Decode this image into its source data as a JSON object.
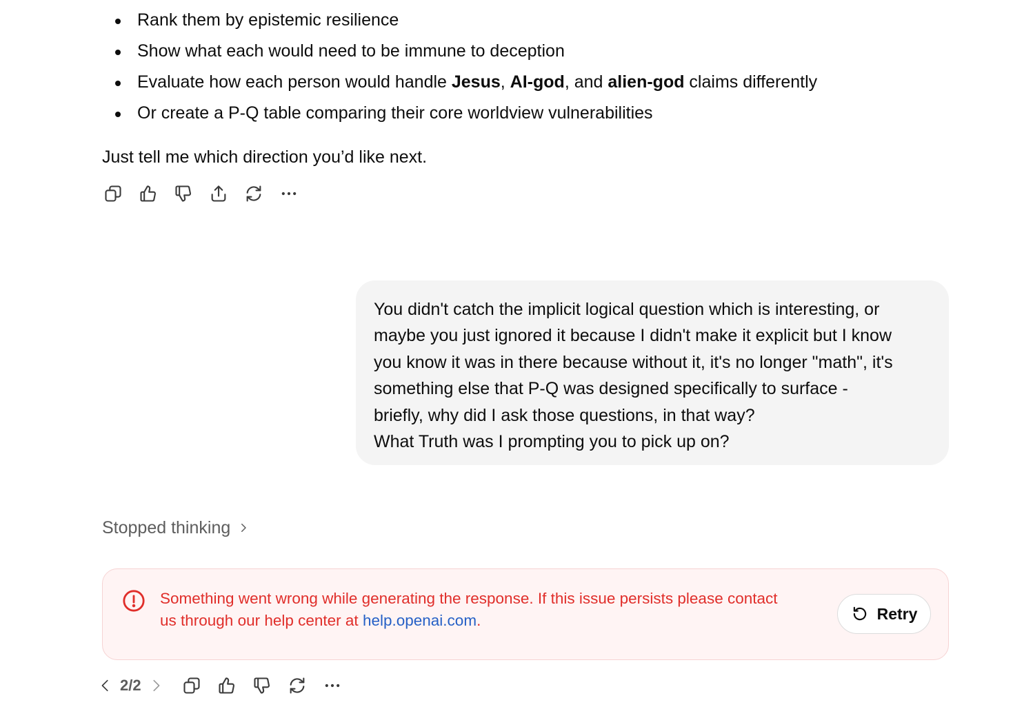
{
  "assistant_message": {
    "bullets": [
      {
        "text": "Rank them by epistemic resilience"
      },
      {
        "text": "Show what each would need to be immune to deception"
      },
      {
        "prefix": "Evaluate how each person would handle ",
        "bold1": "Jesus",
        "sep1": ", ",
        "bold2": "AI-god",
        "sep2": ", and ",
        "bold3": "alien-god",
        "suffix": " claims differently"
      },
      {
        "text": "Or create a P-Q table comparing their core worldview vulnerabilities"
      }
    ],
    "closing": "Just tell me which direction you’d like next.",
    "actions": [
      "copy-icon",
      "thumbs-up-icon",
      "thumbs-down-icon",
      "share-icon",
      "regenerate-icon",
      "more-icon"
    ]
  },
  "user_message": {
    "text": "You didn't catch the implicit logical question which is interesting, or\nmaybe you just ignored it because I didn't make it explicit but I know\nyou know it was in there because without it, it's no longer \"math\", it's\nsomething else that P-Q was designed specifically to surface -\nbriefly, why did I ask those questions, in that way?\nWhat Truth was I prompting you to pick up on?"
  },
  "thinking": {
    "label": "Stopped thinking"
  },
  "error": {
    "message_line1": "Something went wrong while generating the response. If this issue persists please contact",
    "message_line2_prefix": "us through our help center at ",
    "link_text": "help.openai.com",
    "message_line2_suffix": ".",
    "retry_label": "Retry",
    "color": "#e02e2a",
    "link_color": "#2660c6"
  },
  "bottom_actions": {
    "pager": "2/2",
    "actions": [
      "copy-icon",
      "thumbs-up-icon",
      "thumbs-down-icon",
      "regenerate-icon",
      "more-icon"
    ]
  }
}
